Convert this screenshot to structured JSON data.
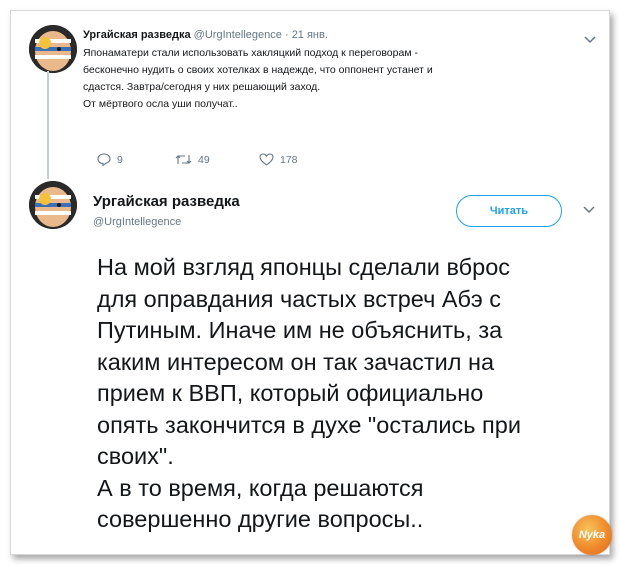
{
  "tweet1": {
    "author_name": "Ургайская разведка",
    "author_handle": "@UrgIntellegence",
    "separator": "·",
    "date": "21 янв.",
    "lines": [
      "Японаматери стали использовать хакляцкий подход к переговорам -",
      "бесконечно нудить о своих хотелках в надежде, что оппонент устанет и",
      "сдастся. Завтра/сегодня у них решающий заход.",
      "От мёртвого осла уши получат.."
    ],
    "replies": "9",
    "retweets": "49",
    "likes": "178"
  },
  "tweet2": {
    "author_name": "Ургайская разведка",
    "author_handle": "@UrgIntellegence",
    "follow_label": "Читать",
    "lines": [
      "На мой взгляд японцы сделали вброс",
      "для оправдания частых встреч Абэ с",
      "Путиным. Иначе им не объяснить, за",
      "каким интересом он так зачастил на",
      "прием к ВВП, который официально",
      "опять закончится в духе \"остались при",
      "своих\".",
      "А в то время, когда решаются",
      "совершенно другие вопросы.."
    ]
  },
  "watermark": {
    "text": "Nyka"
  },
  "colors": {
    "accent": "#1da1f2",
    "muted": "#657786",
    "text": "#14171a"
  }
}
